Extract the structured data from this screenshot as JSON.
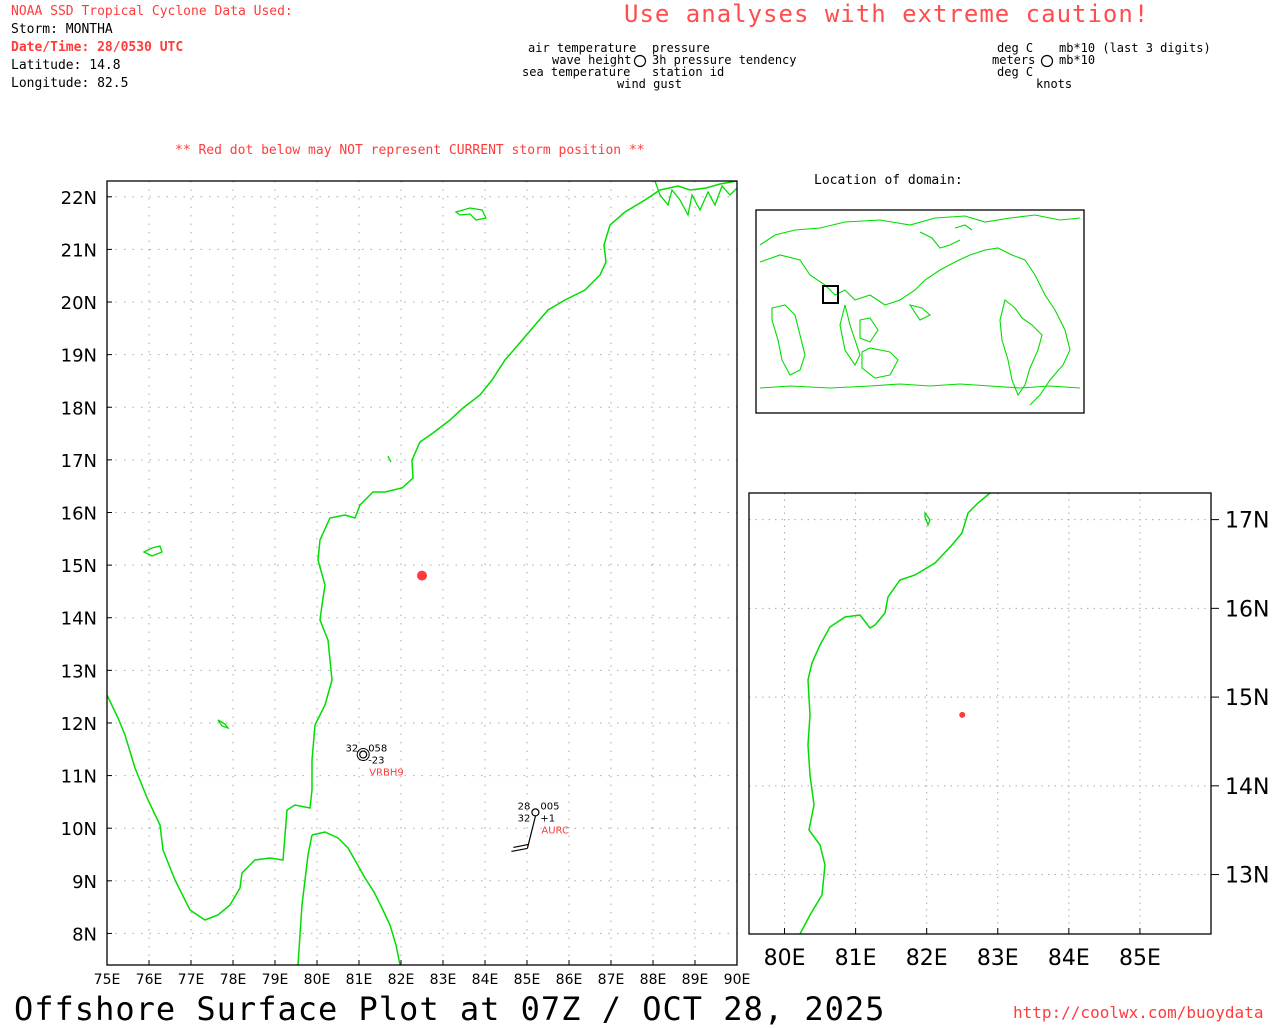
{
  "header": {
    "source_line": "NOAA SSD Tropical Cyclone Data Used:",
    "storm_label": "Storm: MONTHA",
    "datetime_label": "Date/Time: 28/0530 UTC",
    "latitude_label": "Latitude: 14.8",
    "longitude_label": "Longitude: 82.5",
    "caution": "Use analyses with extreme caution!"
  },
  "legend": {
    "left_top1": "air temperature",
    "left_top2": "wave height",
    "left_top3": "sea temperature",
    "right_top1": "pressure",
    "right_top2": "3h pressure tendency",
    "right_top3": "station id",
    "bottom": "wind gust",
    "units_left1": "deg C",
    "units_left2": "meters",
    "units_left3": "deg C",
    "units_right1": "mb*10 (last 3 digits)",
    "units_right2": "mb*10",
    "units_bottom": "knots"
  },
  "warning": "** Red dot below may NOT represent CURRENT storm position **",
  "location_title": "Location of domain:",
  "footer": {
    "title": "Offshore Surface Plot at 07Z / OCT 28, 2025",
    "url": "http://coolwx.com/buoydata"
  },
  "storm": {
    "lat": 14.8,
    "lon": 82.5,
    "color": "#ff3b3b"
  },
  "colors": {
    "coast": "#00dd00",
    "station_id": "#ff3b3b",
    "grid": "#aaaaaa"
  },
  "main_map": {
    "lon_ticks": [
      "75E",
      "76E",
      "77E",
      "78E",
      "79E",
      "80E",
      "81E",
      "82E",
      "83E",
      "84E",
      "85E",
      "86E",
      "87E",
      "88E",
      "89E",
      "90E"
    ],
    "lat_ticks": [
      "8N",
      "9N",
      "10N",
      "11N",
      "12N",
      "13N",
      "14N",
      "15N",
      "16N",
      "17N",
      "18N",
      "19N",
      "20N",
      "21N",
      "22N"
    ]
  },
  "zoom_map": {
    "lon_ticks": [
      "80E",
      "81E",
      "82E",
      "83E",
      "84E",
      "85E"
    ],
    "lat_ticks": [
      "13N",
      "14N",
      "15N",
      "16N",
      "17N"
    ]
  },
  "stations": [
    {
      "id": "VRBH9",
      "air_temp": "32",
      "pressure": "058",
      "tendency": "-23",
      "lat": 11.4,
      "lon": 81.1
    },
    {
      "id": "AURC",
      "air_temp": "28",
      "sea_temp": "32",
      "pressure": "005",
      "tendency": "+1",
      "lat": 10.3,
      "lon": 85.2
    }
  ]
}
